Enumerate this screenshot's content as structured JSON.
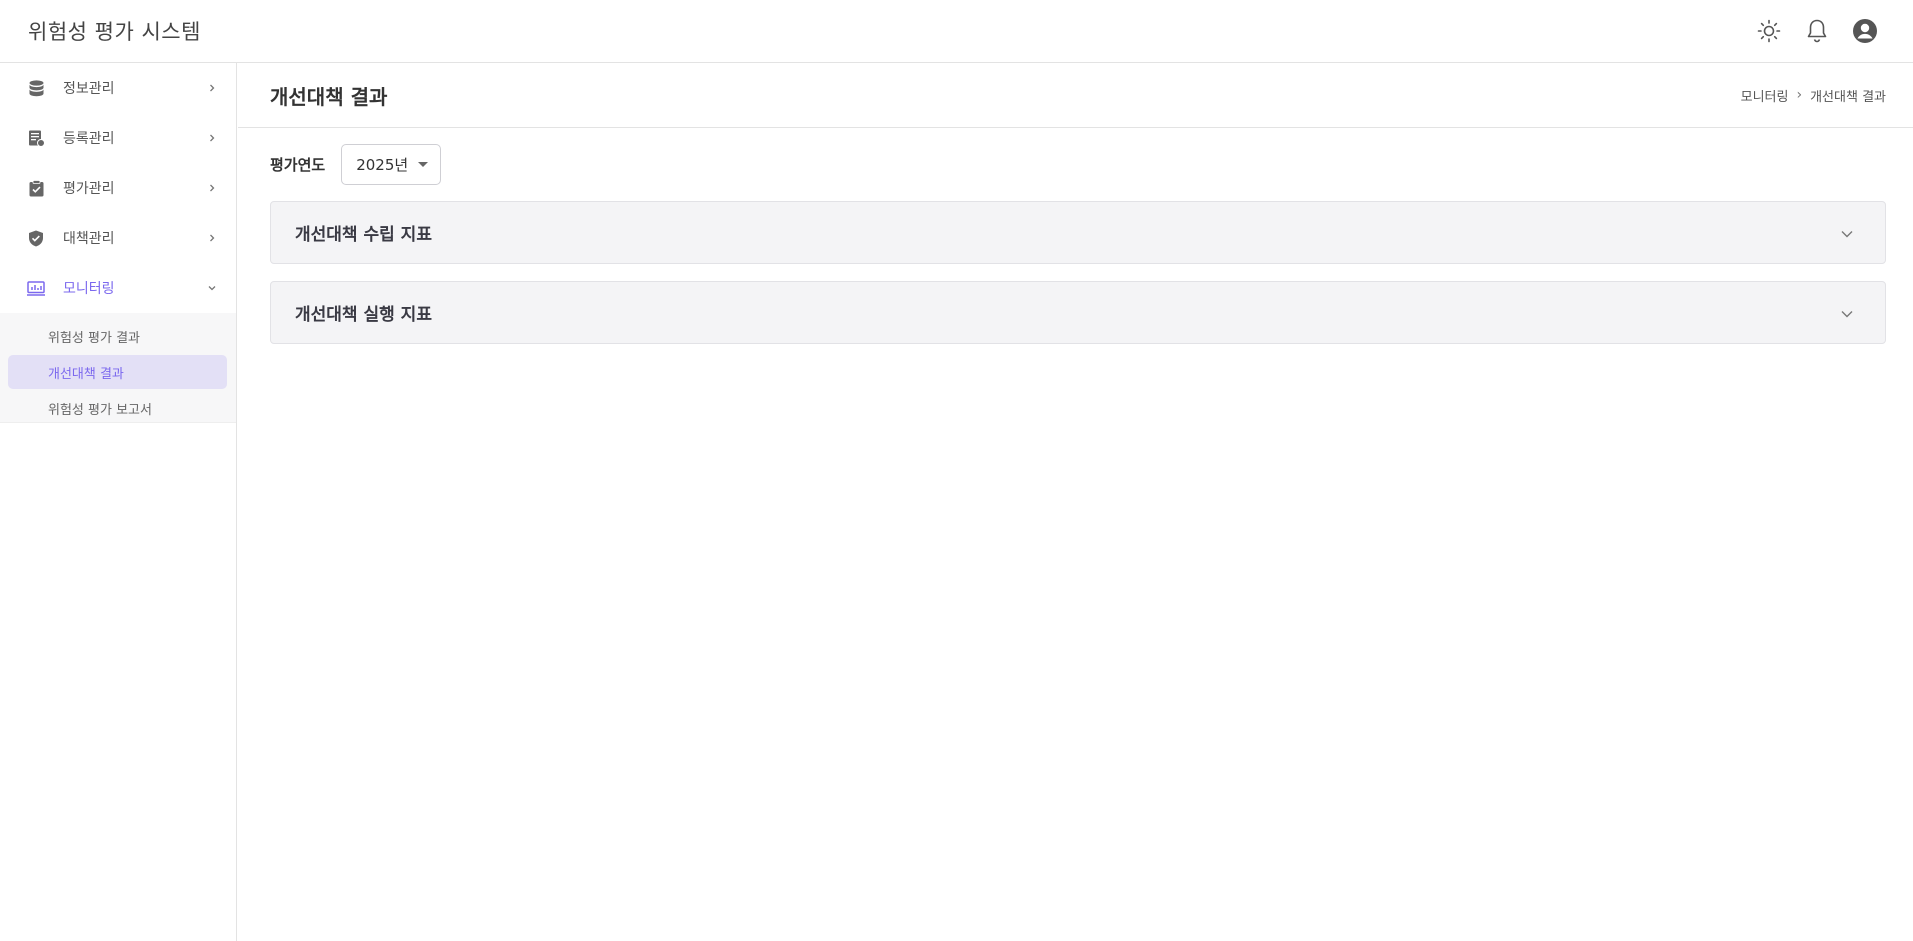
{
  "app": {
    "title": "위험성 평가 시스템"
  },
  "header_icons": [
    {
      "name": "sun-icon"
    },
    {
      "name": "bell-icon"
    },
    {
      "name": "user-avatar-icon"
    }
  ],
  "sidebar": {
    "items": [
      {
        "label": "정보관리",
        "icon": "database-icon",
        "expanded": false
      },
      {
        "label": "등록관리",
        "icon": "registration-icon",
        "expanded": false
      },
      {
        "label": "평가관리",
        "icon": "clipboard-check-icon",
        "expanded": false
      },
      {
        "label": "대책관리",
        "icon": "shield-check-icon",
        "expanded": false
      },
      {
        "label": "모니터링",
        "icon": "monitor-chart-icon",
        "expanded": true
      }
    ],
    "submenu": [
      {
        "label": "위험성 평가 결과"
      },
      {
        "label": "개선대책 결과",
        "selected": true
      },
      {
        "label": "위험성 평가 보고서"
      }
    ],
    "active_color": "#7b68ee"
  },
  "page": {
    "title": "개선대책 결과",
    "breadcrumb": [
      "모니터링",
      "개선대책 결과"
    ],
    "breadcrumb_sep": "›"
  },
  "filter": {
    "label": "평가연도",
    "year_value": "2025년"
  },
  "accordions": [
    {
      "title": "개선대책 수립 지표"
    },
    {
      "title": "개선대책 실행 지표"
    }
  ]
}
